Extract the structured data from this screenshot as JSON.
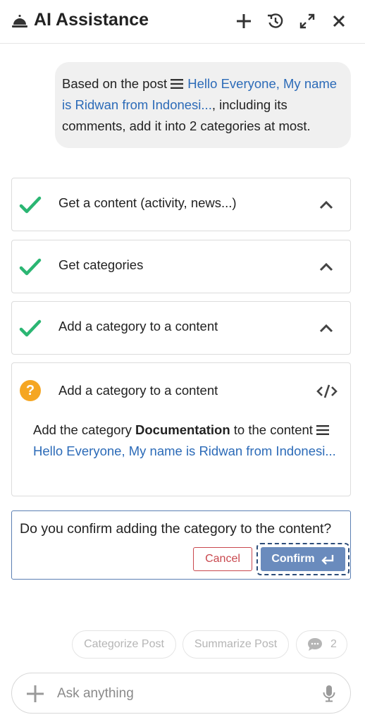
{
  "header": {
    "title": "AI Assistance"
  },
  "user_message": {
    "prefix": "Based on the post ",
    "link_text": "Hello Everyone, My name is Ridwan from Indonesi...",
    "suffix": ", including its comments, add it into 2 categories at most."
  },
  "steps": [
    {
      "label": "Get a content (activity, news...)",
      "status": "done"
    },
    {
      "label": "Get categories",
      "status": "done"
    },
    {
      "label": "Add a category to a content",
      "status": "done"
    }
  ],
  "pending_step": {
    "label": "Add a category to a content",
    "status": "question",
    "desc_prefix": "Add the category ",
    "desc_category": "Documentation",
    "desc_middle": " to the content ",
    "desc_link": "Hello Everyone, My name is Ridwan from Indonesi..."
  },
  "confirmation": {
    "question": "Do you confirm adding the category to the content?",
    "cancel_label": "Cancel",
    "confirm_label": "Confirm"
  },
  "suggestions": [
    {
      "label": "Categorize Post"
    },
    {
      "label": "Summarize Post"
    }
  ],
  "comments_count": "2",
  "composer": {
    "placeholder": "Ask anything"
  },
  "colors": {
    "check_green": "#2bb673",
    "question_orange": "#f5a623",
    "link_blue": "#2c6bb8",
    "confirm_blue": "#6a8bbd",
    "cancel_red": "#c9484e"
  }
}
